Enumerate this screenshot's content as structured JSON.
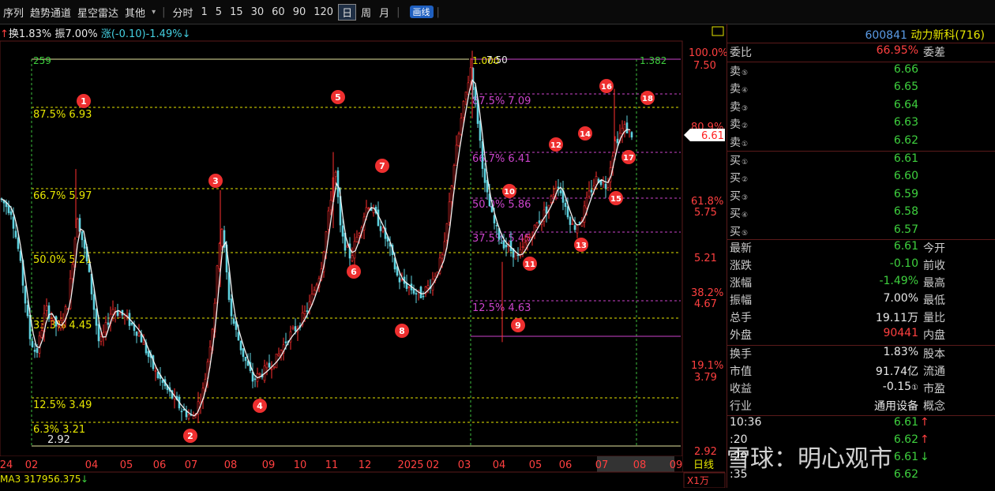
{
  "toolbar": {
    "items": [
      "序列",
      "趋势通道",
      "星空雷达",
      "其他"
    ],
    "dropdown_arrow": "▾",
    "timeframes": [
      "分时",
      "1",
      "5",
      "15",
      "30",
      "60",
      "90",
      "120",
      "日",
      "周",
      "月"
    ],
    "active_timeframe": "日",
    "draw_button": "画线"
  },
  "info_line": {
    "arrow": "↑",
    "turnover": "换1.83%",
    "amplitude": "振7.00%",
    "change": "涨(-0.10)-1.49%",
    "change_arrow": "↓"
  },
  "panel": {
    "stock_code": "600841",
    "stock_name": "动力新科",
    "stock_count": "(716)",
    "weibi_label": "委比",
    "weibi_value": "66.95%",
    "weicha_label": "委差",
    "asks": [
      {
        "label": "卖",
        "level": "⑤",
        "price": "6.66"
      },
      {
        "label": "卖",
        "level": "④",
        "price": "6.65"
      },
      {
        "label": "卖",
        "level": "③",
        "price": "6.64"
      },
      {
        "label": "卖",
        "level": "②",
        "price": "6.63"
      },
      {
        "label": "卖",
        "level": "①",
        "price": "6.62"
      }
    ],
    "bids": [
      {
        "label": "买",
        "level": "①",
        "price": "6.61"
      },
      {
        "label": "买",
        "level": "②",
        "price": "6.60"
      },
      {
        "label": "买",
        "level": "③",
        "price": "6.59"
      },
      {
        "label": "买",
        "level": "④",
        "price": "6.58"
      },
      {
        "label": "买",
        "level": "⑤",
        "price": "6.57"
      }
    ],
    "stats": [
      {
        "left": "最新",
        "value": "6.61",
        "right": "今开",
        "color": "green"
      },
      {
        "left": "涨跌",
        "value": "-0.10",
        "right": "前收",
        "color": "green"
      },
      {
        "left": "涨幅",
        "value": "-1.49%",
        "right": "最高",
        "color": "green"
      },
      {
        "left": "振幅",
        "value": "7.00%",
        "right": "最低",
        "color": "white"
      },
      {
        "left": "总手",
        "value": "19.11万",
        "right": "量比",
        "color": "white"
      },
      {
        "left": "外盘",
        "value": "90441",
        "right": "内盘",
        "color": "red"
      }
    ],
    "stats2": [
      {
        "left": "换手",
        "value": "1.83%",
        "right": "股本",
        "color": "white"
      },
      {
        "left": "市值",
        "value": "91.74亿",
        "right": "流通",
        "color": "white"
      },
      {
        "left": "收益",
        "value": "-0.15",
        "suffix": "①",
        "right": "市盈",
        "color": "white"
      },
      {
        "left": "行业",
        "value": "通用设备",
        "right": "概念",
        "color": "white"
      }
    ],
    "ticks": [
      {
        "time": "10:36",
        "price": "6.61",
        "arrow": "↑"
      },
      {
        "time": ":20",
        "price": "6.62",
        "arrow": "↑"
      },
      {
        "time": ":29",
        "price": "6.61",
        "arrow": "↓"
      },
      {
        "time": ":35",
        "price": "6.62",
        "arrow": ""
      }
    ]
  },
  "watermark": "雪球：明心观市",
  "chart_data": {
    "type": "candlestick",
    "period": "日线",
    "volume_unit": "X1万",
    "ma_label": "MA3 317956.375",
    "ma_arrow": "↓",
    "price_axis_ticks": [
      "7.50",
      "5.75",
      "5.21",
      "4.67",
      "3.79",
      "2.92"
    ],
    "percent_axis_ticks": [
      "100.0%",
      "80.9%",
      "61.8%",
      "38.2%",
      "19.1%"
    ],
    "current_price": "6.61",
    "x_labels": [
      "24",
      "02",
      "04",
      "05",
      "06",
      "07",
      "08",
      "09",
      "10",
      "11",
      "12",
      "2025",
      "02",
      "03",
      "04",
      "05",
      "06",
      "07",
      "08",
      "09"
    ],
    "top_label": "259",
    "low_label": "2.92",
    "peak_label": "7.50",
    "fib_left": [
      "87.5% 6.93",
      "66.7% 5.97",
      "50.0% 5.21",
      "33.3% 4.45",
      "12.5% 3.49",
      "6.3% 3.21"
    ],
    "fib_right": [
      "87.5% 7.09",
      "66.7% 6.41",
      "50.0% 5.86",
      "37.5% 5.45",
      "12.5% 4.63"
    ],
    "time_ratios": [
      "1.000",
      "1.382"
    ],
    "markers": [
      "1",
      "2",
      "3",
      "4",
      "5",
      "6",
      "7",
      "8",
      "9",
      "10",
      "11",
      "12",
      "13",
      "14",
      "15",
      "16",
      "17",
      "18"
    ]
  }
}
